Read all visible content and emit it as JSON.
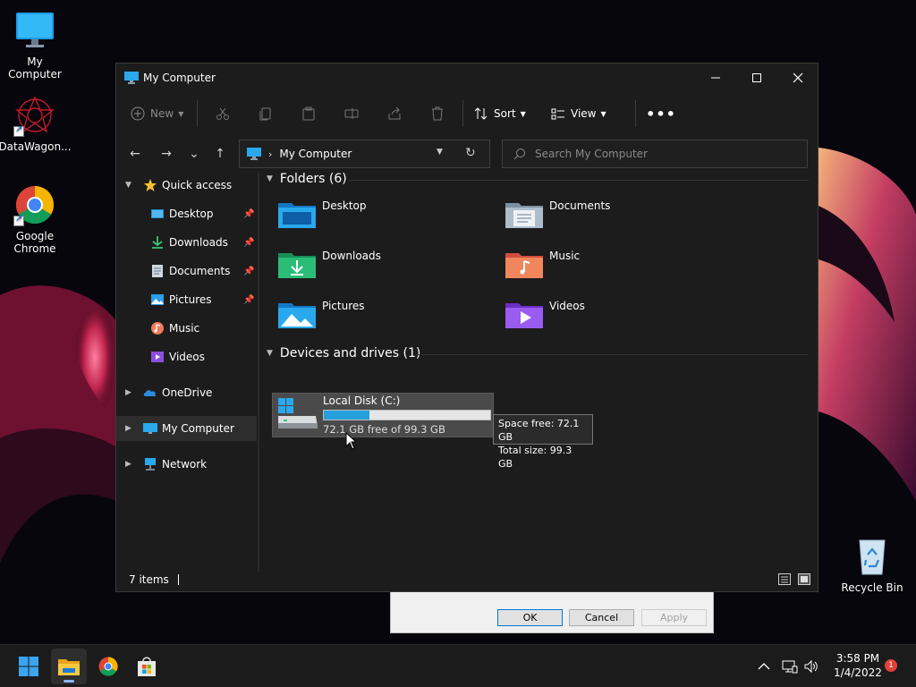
{
  "desktop": {
    "icons": [
      {
        "label": "My Computer",
        "icon": "monitor-icon"
      },
      {
        "label": "DataWagon...",
        "icon": "datawagon-icon"
      },
      {
        "label": "Google Chrome",
        "icon": "chrome-icon"
      },
      {
        "label": "Recycle Bin",
        "icon": "recycle-bin-icon"
      }
    ]
  },
  "window": {
    "title": "My Computer",
    "controls": {
      "minimize": "—",
      "maximize": "☐",
      "close": "✕"
    }
  },
  "toolbar": {
    "new_label": "New",
    "sort_label": "Sort",
    "view_label": "View",
    "more": "•••",
    "icons": [
      "cut-icon",
      "copy-icon",
      "paste-icon",
      "rename-icon",
      "share-icon",
      "delete-icon"
    ]
  },
  "navigation": {
    "back": "←",
    "forward": "→",
    "recent": "⌄",
    "up": "↑",
    "address": "My Computer",
    "search_placeholder": "Search My Computer"
  },
  "sidebar": {
    "items": [
      {
        "label": "Quick access",
        "icon": "star-icon"
      },
      {
        "label": "Desktop",
        "icon": "desktop-icon",
        "pinned": true
      },
      {
        "label": "Downloads",
        "icon": "download-icon",
        "pinned": true
      },
      {
        "label": "Documents",
        "icon": "document-icon",
        "pinned": true
      },
      {
        "label": "Pictures",
        "icon": "picture-icon",
        "pinned": true
      },
      {
        "label": "Music",
        "icon": "music-icon"
      },
      {
        "label": "Videos",
        "icon": "video-icon"
      },
      {
        "label": "OneDrive",
        "icon": "cloud-icon"
      },
      {
        "label": "My Computer",
        "icon": "monitor-icon",
        "selected": true
      },
      {
        "label": "Network",
        "icon": "network-icon"
      }
    ]
  },
  "content": {
    "folders_header": "Folders (6)",
    "folders": [
      {
        "label": "Desktop",
        "icon": "desktop-folder-icon"
      },
      {
        "label": "Documents",
        "icon": "documents-folder-icon"
      },
      {
        "label": "Downloads",
        "icon": "downloads-folder-icon"
      },
      {
        "label": "Music",
        "icon": "music-folder-icon"
      },
      {
        "label": "Pictures",
        "icon": "pictures-folder-icon"
      },
      {
        "label": "Videos",
        "icon": "videos-folder-icon"
      }
    ],
    "drives_header": "Devices and drives (1)",
    "drive": {
      "name": "Local Disk (C:)",
      "free_text": "72.1 GB free of 99.3 GB",
      "used_fraction": 0.274
    },
    "tooltip": {
      "line1": "Space free: 72.1 GB",
      "line2": "Total size: 99.3 GB"
    }
  },
  "status": {
    "items": "7 items"
  },
  "behind_dialog": {
    "ok": "OK",
    "cancel": "Cancel",
    "apply": "Apply"
  },
  "taskbar": {
    "time": "3:58 PM",
    "date": "1/4/2022",
    "notifications": "1",
    "apps": [
      "start-icon",
      "file-explorer-icon",
      "chrome-icon",
      "store-icon"
    ]
  },
  "colors": {
    "accent": "#26a0da",
    "window_bg": "#1c1c1c",
    "taskbar_bg": "#1b1b1b"
  }
}
